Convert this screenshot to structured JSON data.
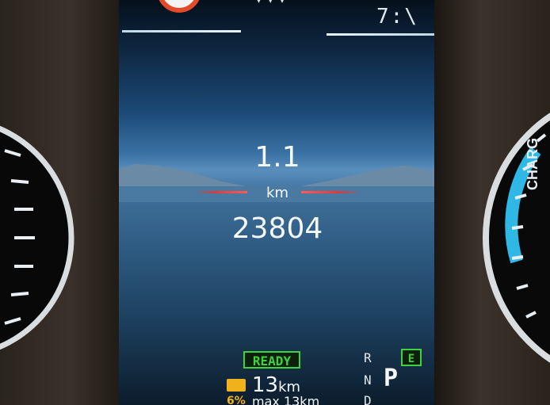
{
  "display": {
    "trip_distance": "1.1",
    "trip_unit": "km",
    "odometer": "23804"
  },
  "status": {
    "ready_label": "READY",
    "range_value": "13",
    "range_unit": "km",
    "battery_percent": "6%",
    "max_range_label": "max 13km"
  },
  "gear": {
    "r": "R",
    "n": "N",
    "d": "D",
    "current": "P",
    "mode_badge": "E"
  },
  "right_gauge": {
    "label": "CHARG"
  },
  "colors": {
    "ready_green": "#3ed23e",
    "battery_amber": "#f0b21c",
    "charge_blue": "#2fb7e6",
    "warning_red": "#e24a2a"
  },
  "icons": [
    "warning-ring-icon",
    "battery-icon"
  ]
}
